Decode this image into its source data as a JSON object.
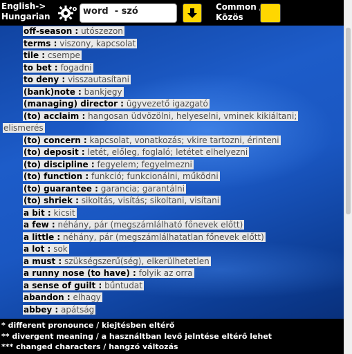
{
  "header": {
    "lang_pair": "English->\nHungarian",
    "search_value": "word  - szó",
    "common_label": "Common /\nKözös"
  },
  "entries": [
    {
      "en": "off-season :",
      "hu": "utószezon"
    },
    {
      "en": "terms :",
      "hu": "viszony, kapcsolat"
    },
    {
      "en": "tile :",
      "hu": "csempe"
    },
    {
      "en": "to bet :",
      "hu": "fogadni"
    },
    {
      "en": "to deny :",
      "hu": "visszautasítani"
    },
    {
      "en": "(bank)note :",
      "hu": "bankjegy"
    },
    {
      "en": "(managing) director :",
      "hu": "ügyvezető igazgató"
    },
    {
      "en": "(to) acclaim :",
      "hu": "hangosan üdvözölni, helyeselni, vminek kikiáltani;",
      "cont": "elismerés"
    },
    {
      "en": "(to) concern :",
      "hu": "kapcsolat, vonatkozás; vkire tartozni, érinteni"
    },
    {
      "en": "(to) deposit :",
      "hu": "letét, előleg, foglaló; letétet elhelyezni"
    },
    {
      "en": "(to) discipline :",
      "hu": "fegyelem; fegyelmezni"
    },
    {
      "en": "(to) function :",
      "hu": "funkció; funkcionálni, működni"
    },
    {
      "en": "(to) guarantee :",
      "hu": "garancia; garantálni"
    },
    {
      "en": "(to) shriek :",
      "hu": "sikoltás, visítás; sikoltani, visítani"
    },
    {
      "en": "a bit :",
      "hu": "kicsit"
    },
    {
      "en": "a few :",
      "hu": "néhány, pár (megszámlálható főnevek előtt)"
    },
    {
      "en": "a little :",
      "hu": "néhány, pár (megszámlálhatatlan főnevek előtt)"
    },
    {
      "en": "a lot :",
      "hu": "sok"
    },
    {
      "en": "a must :",
      "hu": "szükségszerű(ség), elkerülhetetlen"
    },
    {
      "en": "a runny nose (to have) :",
      "hu": "folyik az orra"
    },
    {
      "en": "a sense of guilt :",
      "hu": "bűntudat"
    },
    {
      "en": "abandon :",
      "hu": "elhagy"
    },
    {
      "en": "abbey :",
      "hu": "apátság"
    }
  ],
  "footer": {
    "line1": "* different pronounce / kiejtésben eltérő",
    "line2": "** divergent meaning / a használtban levő jelntése eltérő lehet",
    "line3": "*** changed characters / hangzó változás"
  }
}
